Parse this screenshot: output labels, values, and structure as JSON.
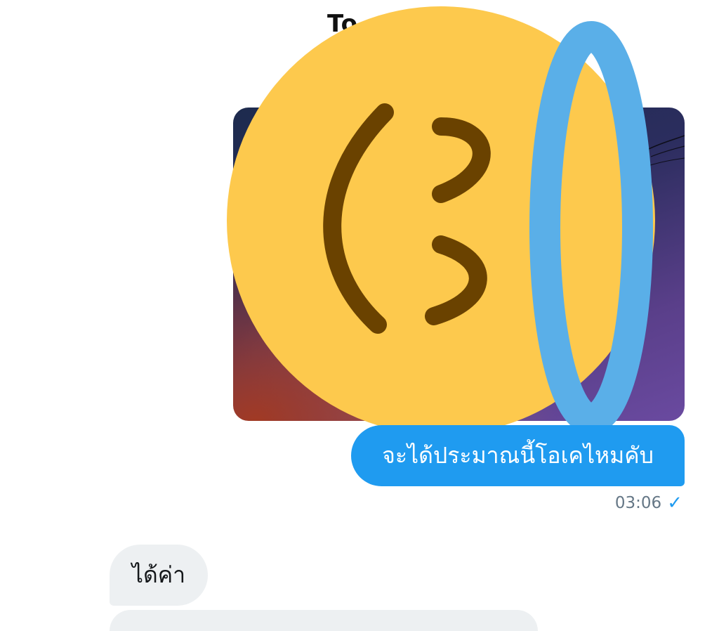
{
  "conversation": {
    "header_peek": "To",
    "messages": [
      {
        "direction": "outgoing",
        "text": "จะได้ประมาณนี้โอเคไหมคับ",
        "time": "03:06",
        "status_icon": "checkmark-icon"
      },
      {
        "direction": "incoming",
        "text": "ได้ค่า"
      }
    ]
  },
  "sticker": {
    "icon": "censor-face-sticker",
    "face_color": "#FDC94D",
    "feature_color": "#6A4200",
    "ring_color": "#5AAFE8"
  },
  "colors": {
    "outgoing_bubble": "#1F9BF0",
    "incoming_bubble": "#EDF0F2",
    "timestamp": "#657786"
  }
}
